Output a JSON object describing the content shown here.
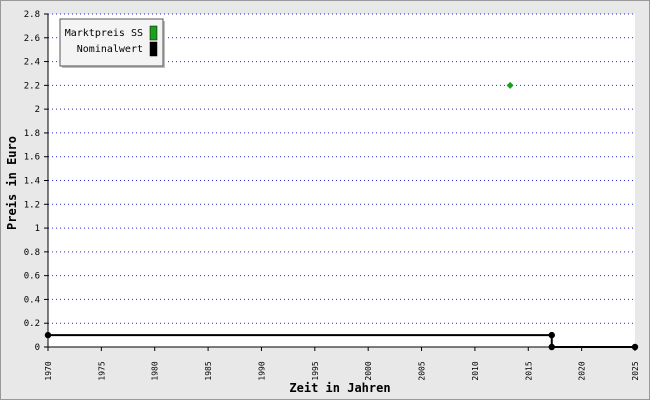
{
  "chart_data": {
    "type": "line",
    "xlabel": "Zeit in Jahren",
    "ylabel": "Preis in Euro",
    "xlim": [
      1970,
      2025
    ],
    "ylim": [
      0,
      2.8
    ],
    "x_ticks": [
      1970,
      1975,
      1980,
      1985,
      1990,
      1995,
      2000,
      2005,
      2010,
      2015,
      2020,
      2025
    ],
    "y_ticks": [
      0,
      0.2,
      0.4,
      0.6,
      0.8,
      1,
      1.2,
      1.4,
      1.6,
      1.8,
      2,
      2.2,
      2.4,
      2.6,
      2.8
    ],
    "grid": "horizontal dotted",
    "legend": "top-left",
    "series": [
      {
        "name": "Marktpreis SS",
        "color": "#1e9e1e",
        "style": "point",
        "points": [
          [
            2013.3,
            2.2
          ]
        ]
      },
      {
        "name": "Nominalwert",
        "color": "#000000",
        "style": "step-line",
        "points": [
          [
            1970,
            0.1
          ],
          [
            2017.2,
            0.1
          ],
          [
            2017.2,
            0
          ],
          [
            2025,
            0
          ]
        ]
      }
    ]
  }
}
